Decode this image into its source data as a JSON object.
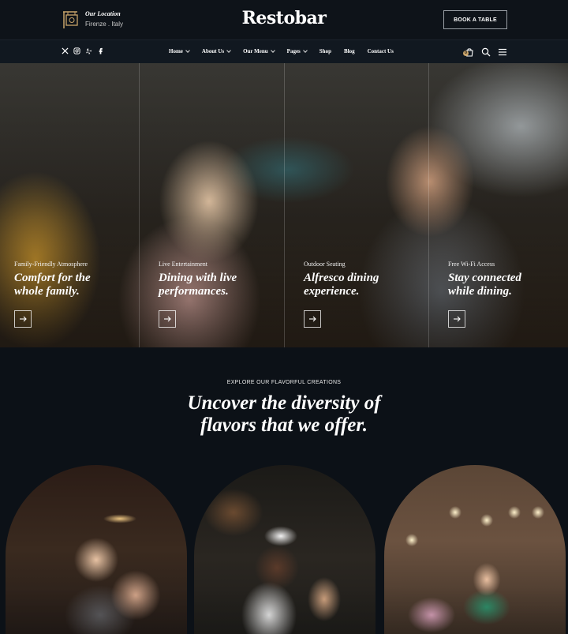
{
  "header": {
    "location_title": "Our Location",
    "location_city": "Firenze . Italy",
    "logo": "Restobar",
    "book_button": "BOOK A TABLE"
  },
  "nav": {
    "social_icons": [
      "x-icon",
      "instagram-icon",
      "yelp-icon",
      "facebook-icon"
    ],
    "items": [
      {
        "label": "Home",
        "dropdown": true
      },
      {
        "label": "About Us",
        "dropdown": true
      },
      {
        "label": "Our Menu",
        "dropdown": true
      },
      {
        "label": "Pages",
        "dropdown": true
      },
      {
        "label": "Shop",
        "dropdown": false
      },
      {
        "label": "Blog",
        "dropdown": false
      },
      {
        "label": "Contact Us",
        "dropdown": false
      }
    ],
    "cart_count": "0",
    "right_icons": [
      "cart-icon",
      "search-icon",
      "menu-icon"
    ]
  },
  "hero": {
    "features": [
      {
        "eyebrow": "Family-Friendly Atmosphere",
        "title_line1": "Comfort for the",
        "title_line2": "whole family."
      },
      {
        "eyebrow": "Live Entertainment",
        "title_line1": "Dining with live",
        "title_line2": "performances."
      },
      {
        "eyebrow": "Outdoor Seating",
        "title_line1": "Alfresco dining",
        "title_line2": "experience."
      },
      {
        "eyebrow": "Free Wi-Fi Access",
        "title_line1": "Stay connected",
        "title_line2": "while dining."
      }
    ]
  },
  "section": {
    "eyebrow": "EXPLORE OUR FLAVORFUL CREATIONS",
    "heading_line1": "Uncover the diversity of",
    "heading_line2": "flavors that we offer."
  },
  "colors": {
    "background": "#0c1117",
    "topbar": "#0e1319",
    "navbar": "#111820",
    "accent_badge": "#c9a46a"
  }
}
